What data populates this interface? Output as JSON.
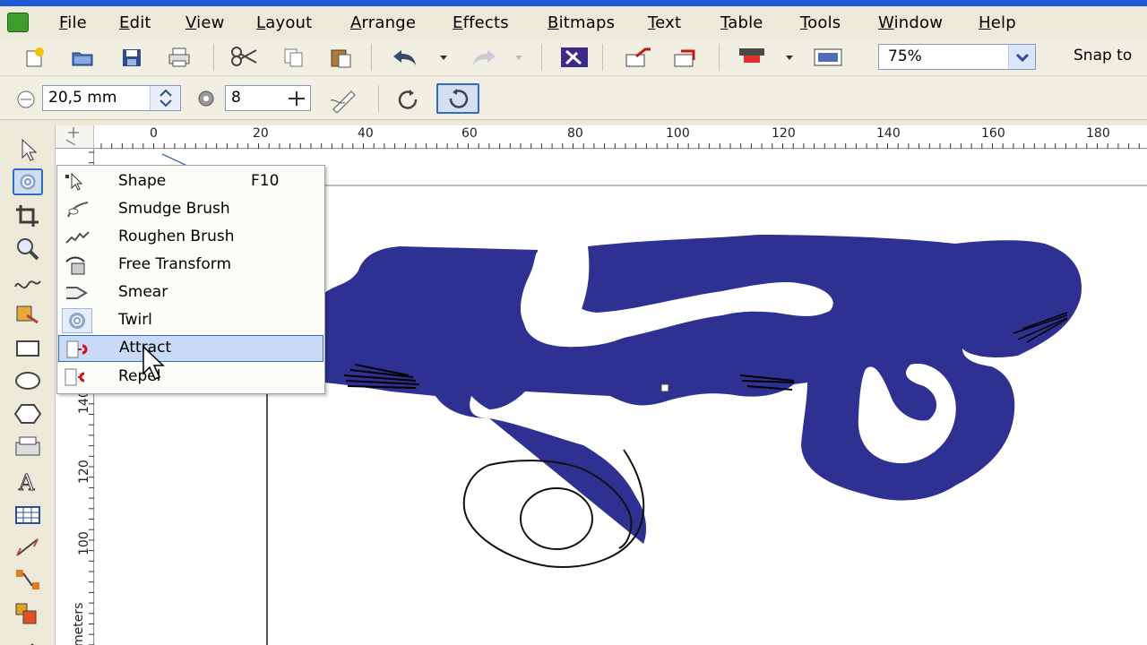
{
  "menu": {
    "items": [
      {
        "label": "File"
      },
      {
        "label": "Edit"
      },
      {
        "label": "View"
      },
      {
        "label": "Layout"
      },
      {
        "label": "Arrange"
      },
      {
        "label": "Effects"
      },
      {
        "label": "Bitmaps"
      },
      {
        "label": "Text"
      },
      {
        "label": "Table"
      },
      {
        "label": "Tools"
      },
      {
        "label": "Window"
      },
      {
        "label": "Help"
      }
    ]
  },
  "toolbar": {
    "zoom_value": "75%",
    "snap_label": "Snap to"
  },
  "property_bar": {
    "size_value": "20,5 mm",
    "rate_value": "8"
  },
  "ruler": {
    "top_ticks": [
      "0",
      "20",
      "40",
      "60",
      "80",
      "100",
      "120",
      "140",
      "160",
      "180"
    ],
    "left_ticks": [
      "140",
      "120",
      "100"
    ],
    "unit_label": "meters"
  },
  "flyout": {
    "items": [
      {
        "label": "Shape",
        "shortcut": "F10",
        "icon": "shape-tool-icon"
      },
      {
        "label": "Smudge Brush",
        "shortcut": "",
        "icon": "smudge-brush-icon"
      },
      {
        "label": "Roughen Brush",
        "shortcut": "",
        "icon": "roughen-brush-icon"
      },
      {
        "label": "Free Transform",
        "shortcut": "",
        "icon": "free-transform-icon"
      },
      {
        "label": "Smear",
        "shortcut": "",
        "icon": "smear-icon"
      },
      {
        "label": "Twirl",
        "shortcut": "",
        "icon": "twirl-icon"
      },
      {
        "label": "Attract",
        "shortcut": "",
        "icon": "attract-icon"
      },
      {
        "label": "Repel",
        "shortcut": "",
        "icon": "repel-icon"
      }
    ],
    "highlighted": "Attract",
    "active": "Twirl"
  },
  "colors": {
    "shape_fill": "#2e3192",
    "selection": "#316ac5",
    "highlight": "#c9daf6"
  }
}
